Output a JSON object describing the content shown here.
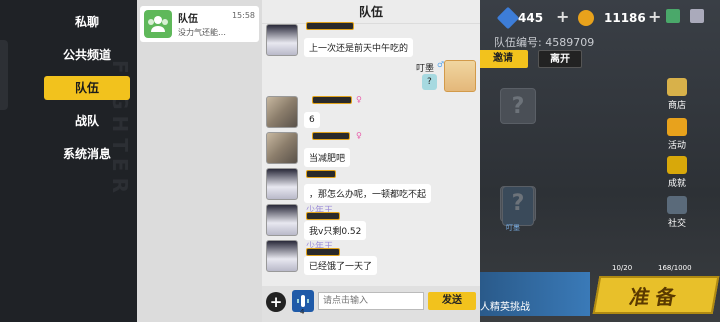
{
  "categories": [
    {
      "label": "私聊",
      "active": false
    },
    {
      "label": "公共频道",
      "active": false
    },
    {
      "label": "队伍",
      "active": true
    },
    {
      "label": "战队",
      "active": false
    },
    {
      "label": "系统消息",
      "active": false
    }
  ],
  "conversation": {
    "title": "队伍",
    "time": "15:58",
    "preview": "没力气还能…"
  },
  "chat": {
    "header": "队伍",
    "messages": [
      {
        "sender_name": "",
        "avatar": "anime",
        "text": "上一次还是前天中午吃的",
        "side": "left"
      },
      {
        "sender_name": "叮墨",
        "avatar": "self",
        "text": "?",
        "side": "right"
      },
      {
        "sender_name": "",
        "avatar": "photo",
        "text": "6",
        "side": "left"
      },
      {
        "sender_name": "",
        "avatar": "photo",
        "text": "当减肥吧",
        "side": "left"
      },
      {
        "sender_name": "",
        "avatar": "anime",
        "text": "，那怎么办呢，一顿都吃不起",
        "side": "left"
      },
      {
        "sender_name": "少年王",
        "avatar": "anime",
        "text": "我v只剩0.52",
        "side": "left"
      },
      {
        "sender_name": "少年王",
        "avatar": "anime",
        "text": "已经饿了一天了",
        "side": "left"
      }
    ],
    "input_placeholder": "请点击输入",
    "voice_count": "4",
    "send_label": "发送"
  },
  "game": {
    "gems": "445",
    "coins": "11186",
    "team_number": "队伍编号: 4589709",
    "invite_label": "邀请",
    "leave_label": "离开",
    "side_menu": [
      "商店",
      "活动",
      "成就",
      "社交"
    ],
    "slot_label": "叮墨",
    "level_left": "10/20",
    "level_right": "168/1000",
    "ready_label": "准备",
    "challenge_label": "人精英挑战"
  }
}
